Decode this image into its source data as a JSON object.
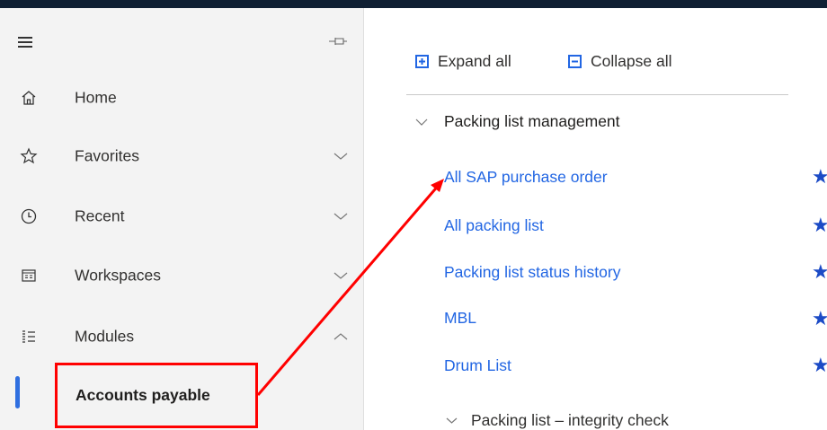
{
  "sidebar": {
    "items": [
      {
        "label": "Home",
        "icon": "home-icon"
      },
      {
        "label": "Favorites",
        "icon": "star-outline-icon"
      },
      {
        "label": "Recent",
        "icon": "clock-icon"
      },
      {
        "label": "Workspaces",
        "icon": "workspace-icon"
      },
      {
        "label": "Modules",
        "icon": "list-icon"
      }
    ],
    "active_module": "Accounts payable"
  },
  "toolbar": {
    "expand_all": "Expand all",
    "collapse_all": "Collapse all"
  },
  "content": {
    "group_title": "Packing list management",
    "links": [
      {
        "label": "All SAP purchase order"
      },
      {
        "label": "All packing list"
      },
      {
        "label": "Packing list status history"
      },
      {
        "label": "MBL"
      },
      {
        "label": "Drum List"
      }
    ],
    "next_group_title": "Packing list – integrity check"
  },
  "colors": {
    "accent": "#2f6fe0",
    "link": "#2266e3",
    "annotation": "#ff0000",
    "star": "#1c4bc6"
  }
}
